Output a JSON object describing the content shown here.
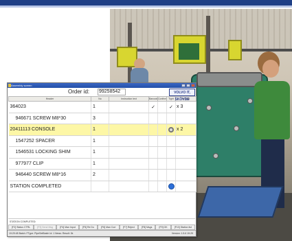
{
  "window": {
    "title": "Assembly screen"
  },
  "order": {
    "label": "Order id:",
    "value": "99258542"
  },
  "logo": {
    "text": "VOLVO IT, SKÖVDE"
  },
  "columns": [
    "Header",
    "No",
    "Instruction text",
    "Barcode",
    "Confirm",
    "Tight",
    "In Tight"
  ],
  "rows": [
    {
      "header": "364023",
      "no": "1",
      "barcode": "✓",
      "tight": "✓",
      "sig": "x 3",
      "indent": false,
      "highlight": false
    },
    {
      "header": "946671 SCREW M8*30",
      "no": "3",
      "indent": true,
      "highlight": false
    },
    {
      "header": "20411113 CONSOLE",
      "no": "1",
      "sig": "x 2",
      "indent": false,
      "highlight": true,
      "icon": "spinner-icon"
    },
    {
      "header": "1547252 SPACER",
      "no": "1",
      "indent": true,
      "highlight": false
    },
    {
      "header": "1546531 LOCKING SHIM",
      "no": "1",
      "indent": true,
      "highlight": false
    },
    {
      "header": "977977 CLIP",
      "no": "1",
      "indent": true,
      "highlight": false
    },
    {
      "header": "946440 SCREW M8*16",
      "no": "2",
      "indent": true,
      "highlight": false
    },
    {
      "header": "STATION COMPLETED",
      "no": "",
      "indent": false,
      "highlight": false,
      "icon": "blue-dot-icon"
    }
  ],
  "status_line": "STATION COMPLETED:",
  "function_keys": [
    {
      "label": "[F2] Status CTRL",
      "dim": false
    },
    {
      "label": "[F3] Send Msg",
      "dim": true
    },
    {
      "label": "[F4] Man Input",
      "dim": false
    },
    {
      "label": "[F5] Re Do",
      "dim": false
    },
    {
      "label": "[F6] Man Corr",
      "dim": false
    },
    {
      "label": "[F7] Reject",
      "dim": false
    },
    {
      "label": "[F8] Msgs",
      "dim": false
    },
    {
      "label": "[F9] OK",
      "dim": false
    },
    {
      "label": "[F10] Station list",
      "dim": false
    }
  ],
  "bottom_status": {
    "left": "19:29:45 Batch: FType: PipeSetBatch Id: 1 News: Result: 0k",
    "version": "Version: 1.5.6    19:29"
  },
  "colors": {
    "highlight": "#fdf7a6",
    "titlebar": "#2450a8",
    "top_band": "#1f3f86",
    "complete_dot": "#2c6fd8"
  }
}
